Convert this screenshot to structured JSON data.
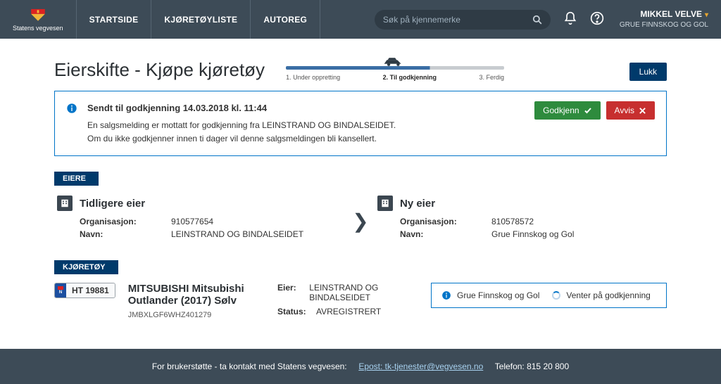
{
  "header": {
    "org_label": "Statens vegvesen",
    "nav": {
      "start": "STARTSIDE",
      "list": "KJØRETØYLISTE",
      "autoreg": "AUTOREG"
    },
    "search": {
      "placeholder": "Søk på kjennemerke"
    },
    "user": {
      "name": "MIKKEL VELVE",
      "org": "GRUE FINNSKOG OG GOL"
    }
  },
  "page": {
    "title": "Eierskifte - Kjøpe kjøretøy",
    "close": "Lukk",
    "progress": {
      "step1": "1. Under oppretting",
      "step2": "2. Til godkjenning",
      "step3": "3. Ferdig"
    }
  },
  "notice": {
    "title": "Sendt til godkjenning 14.03.2018 kl. 11:44",
    "line1": "En salgsmelding er mottatt for godkjenning fra LEINSTRAND OG BINDALSEIDET.",
    "line2": "Om du ikke godkjenner innen ti dager vil denne salgsmeldingen bli kansellert.",
    "approve": "Godkjenn",
    "reject": "Avvis"
  },
  "owners": {
    "tag": "EIERE",
    "labels": {
      "org": "Organisasjon:",
      "name": "Navn:"
    },
    "prev": {
      "heading": "Tidligere eier",
      "org": "910577654",
      "name": "LEINSTRAND OG BINDALSEIDET"
    },
    "next": {
      "heading": "Ny eier",
      "org": "810578572",
      "name": "Grue Finnskog og Gol"
    }
  },
  "vehicle": {
    "tag": "KJØRETØY",
    "plate": "HT 19881",
    "plate_country": "N",
    "title": "MITSUBISHI Mitsubishi Outlander (2017) Sølv",
    "vin": "JMBXLGF6WHZ401279",
    "labels": {
      "owner": "Eier:",
      "status": "Status:"
    },
    "owner": "LEINSTRAND OG BINDALSEIDET",
    "status": "AVREGISTRERT",
    "status_box": {
      "buyer": "Grue Finnskog og Gol",
      "state": "Venter på godkjenning"
    }
  },
  "footer": {
    "text": "For brukerstøtte - ta kontakt med Statens vegvesen:",
    "email_label": "Epost: tk-tjenester@vegvesen.no",
    "phone_label": "Telefon: 815 20 800"
  }
}
